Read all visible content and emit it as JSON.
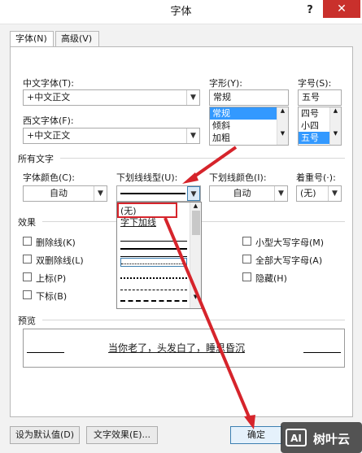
{
  "window": {
    "title": "字体",
    "help_label": "?",
    "close_label": "✕"
  },
  "tabs": [
    {
      "label": "字体(N)",
      "active": true
    },
    {
      "label": "高级(V)",
      "active": false
    }
  ],
  "fonts": {
    "chinese_label": "中文字体(T):",
    "chinese_value": "+中文正文",
    "western_label": "西文字体(F):",
    "western_value": "+中文正文"
  },
  "style": {
    "label": "字形(Y):",
    "value": "常规",
    "options": [
      "常规",
      "倾斜",
      "加粗"
    ],
    "selected_index": 0
  },
  "size": {
    "label": "字号(S):",
    "value": "五号",
    "options": [
      "四号",
      "小四",
      "五号"
    ],
    "selected_index": 2
  },
  "all_text": {
    "section_label": "所有文字",
    "font_color_label": "字体颜色(C):",
    "font_color_value": "自动",
    "underline_type_label": "下划线线型(U):",
    "underline_color_label": "下划线颜色(I):",
    "underline_color_value": "自动",
    "emphasis_label": "着重号(·):",
    "emphasis_value": "(无)"
  },
  "underline_dropdown": {
    "options": [
      "(无)",
      "字下加线"
    ],
    "selected_index": 0
  },
  "effects": {
    "section_label": "效果",
    "left": [
      "删除线(K)",
      "双删除线(L)",
      "上标(P)",
      "下标(B)"
    ],
    "right": [
      "小型大写字母(M)",
      "全部大写字母(A)",
      "隐藏(H)"
    ]
  },
  "preview": {
    "section_label": "预览",
    "text": "当你老了，头发白了，睡思昏沉"
  },
  "footer": {
    "default_button": "设为默认值(D)",
    "text_effects_button": "文字效果(E)...",
    "ok_button": "确定"
  },
  "watermark": {
    "text": "树叶云",
    "logo": "AI"
  },
  "colors": {
    "close_red": "#c9302c",
    "highlight": "#d6242b",
    "selection": "#3399ff"
  }
}
